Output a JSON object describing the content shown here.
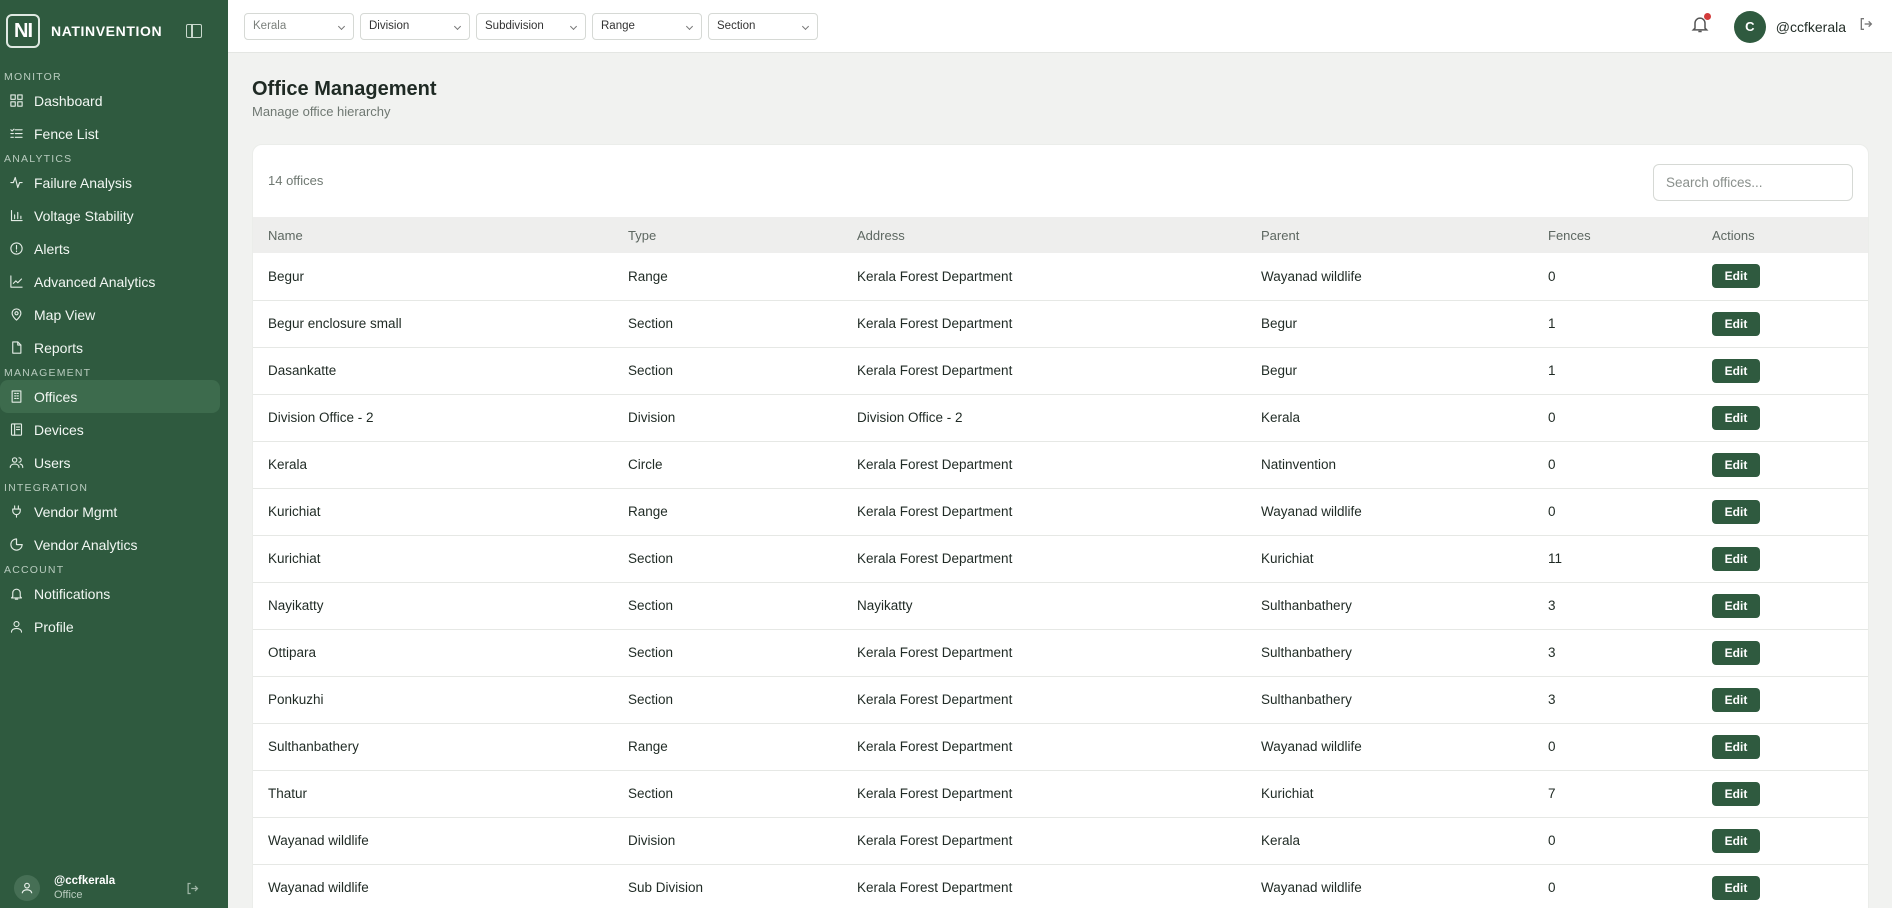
{
  "brand": {
    "logo": "NI",
    "name": "NATINVENTION"
  },
  "sidebar": {
    "sections": [
      {
        "label": "MONITOR",
        "items": [
          {
            "label": "Dashboard",
            "icon": "grid-icon"
          },
          {
            "label": "Fence List",
            "icon": "list-icon"
          }
        ]
      },
      {
        "label": "ANALYTICS",
        "items": [
          {
            "label": "Failure Analysis",
            "icon": "activity-icon"
          },
          {
            "label": "Voltage Stability",
            "icon": "bar-chart-icon"
          },
          {
            "label": "Alerts",
            "icon": "alert-circle-icon"
          },
          {
            "label": "Advanced Analytics",
            "icon": "trend-icon"
          },
          {
            "label": "Map View",
            "icon": "map-pin-icon"
          },
          {
            "label": "Reports",
            "icon": "file-icon"
          }
        ]
      },
      {
        "label": "MANAGEMENT",
        "items": [
          {
            "label": "Offices",
            "icon": "building-icon",
            "active": true
          },
          {
            "label": "Devices",
            "icon": "device-icon"
          },
          {
            "label": "Users",
            "icon": "users-icon"
          }
        ]
      },
      {
        "label": "INTEGRATION",
        "items": [
          {
            "label": "Vendor Mgmt",
            "icon": "plug-icon"
          },
          {
            "label": "Vendor Analytics",
            "icon": "pie-icon"
          }
        ]
      },
      {
        "label": "ACCOUNT",
        "items": [
          {
            "label": "Notifications",
            "icon": "bell-icon"
          },
          {
            "label": "Profile",
            "icon": "user-icon"
          }
        ]
      }
    ],
    "user": {
      "name": "@ccfkerala",
      "role": "Office"
    }
  },
  "topbar": {
    "filters": [
      "Kerala",
      "Division",
      "Subdivision",
      "Range",
      "Section"
    ],
    "username": "@ccfkerala",
    "avatar_letter": "C"
  },
  "page": {
    "title": "Office Management",
    "subtitle": "Manage office hierarchy"
  },
  "table": {
    "count_label": "14 offices",
    "search_placeholder": "Search offices...",
    "edit_label": "Edit",
    "columns": [
      "Name",
      "Type",
      "Address",
      "Parent",
      "Fences",
      "Actions"
    ],
    "rows": [
      [
        "Begur",
        "Range",
        "Kerala Forest Department",
        "Wayanad wildlife",
        "0"
      ],
      [
        "Begur enclosure small",
        "Section",
        "Kerala Forest Department",
        "Begur",
        "1"
      ],
      [
        "Dasankatte",
        "Section",
        "Kerala Forest Department",
        "Begur",
        "1"
      ],
      [
        "Division Office - 2",
        "Division",
        "Division Office - 2",
        "Kerala",
        "0"
      ],
      [
        "Kerala",
        "Circle",
        "Kerala Forest Department",
        "Natinvention",
        "0"
      ],
      [
        "Kurichiat",
        "Range",
        "Kerala Forest Department",
        "Wayanad wildlife",
        "0"
      ],
      [
        "Kurichiat",
        "Section",
        "Kerala Forest Department",
        "Kurichiat",
        "11"
      ],
      [
        "Nayikatty",
        "Section",
        "Nayikatty",
        "Sulthanbathery",
        "3"
      ],
      [
        "Ottipara",
        "Section",
        "Kerala Forest Department",
        "Sulthanbathery",
        "3"
      ],
      [
        "Ponkuzhi",
        "Section",
        "Kerala Forest Department",
        "Sulthanbathery",
        "3"
      ],
      [
        "Sulthanbathery",
        "Range",
        "Kerala Forest Department",
        "Wayanad wildlife",
        "0"
      ],
      [
        "Thatur",
        "Section",
        "Kerala Forest Department",
        "Kurichiat",
        "7"
      ],
      [
        "Wayanad wildlife",
        "Division",
        "Kerala Forest Department",
        "Kerala",
        "0"
      ],
      [
        "Wayanad wildlife",
        "Sub Division",
        "Kerala Forest Department",
        "Wayanad wildlife",
        "0"
      ]
    ]
  },
  "colors": {
    "sidebar": "#2f5a3f",
    "accent": "#2f5a3f",
    "notification_dot": "#d23b3b"
  }
}
